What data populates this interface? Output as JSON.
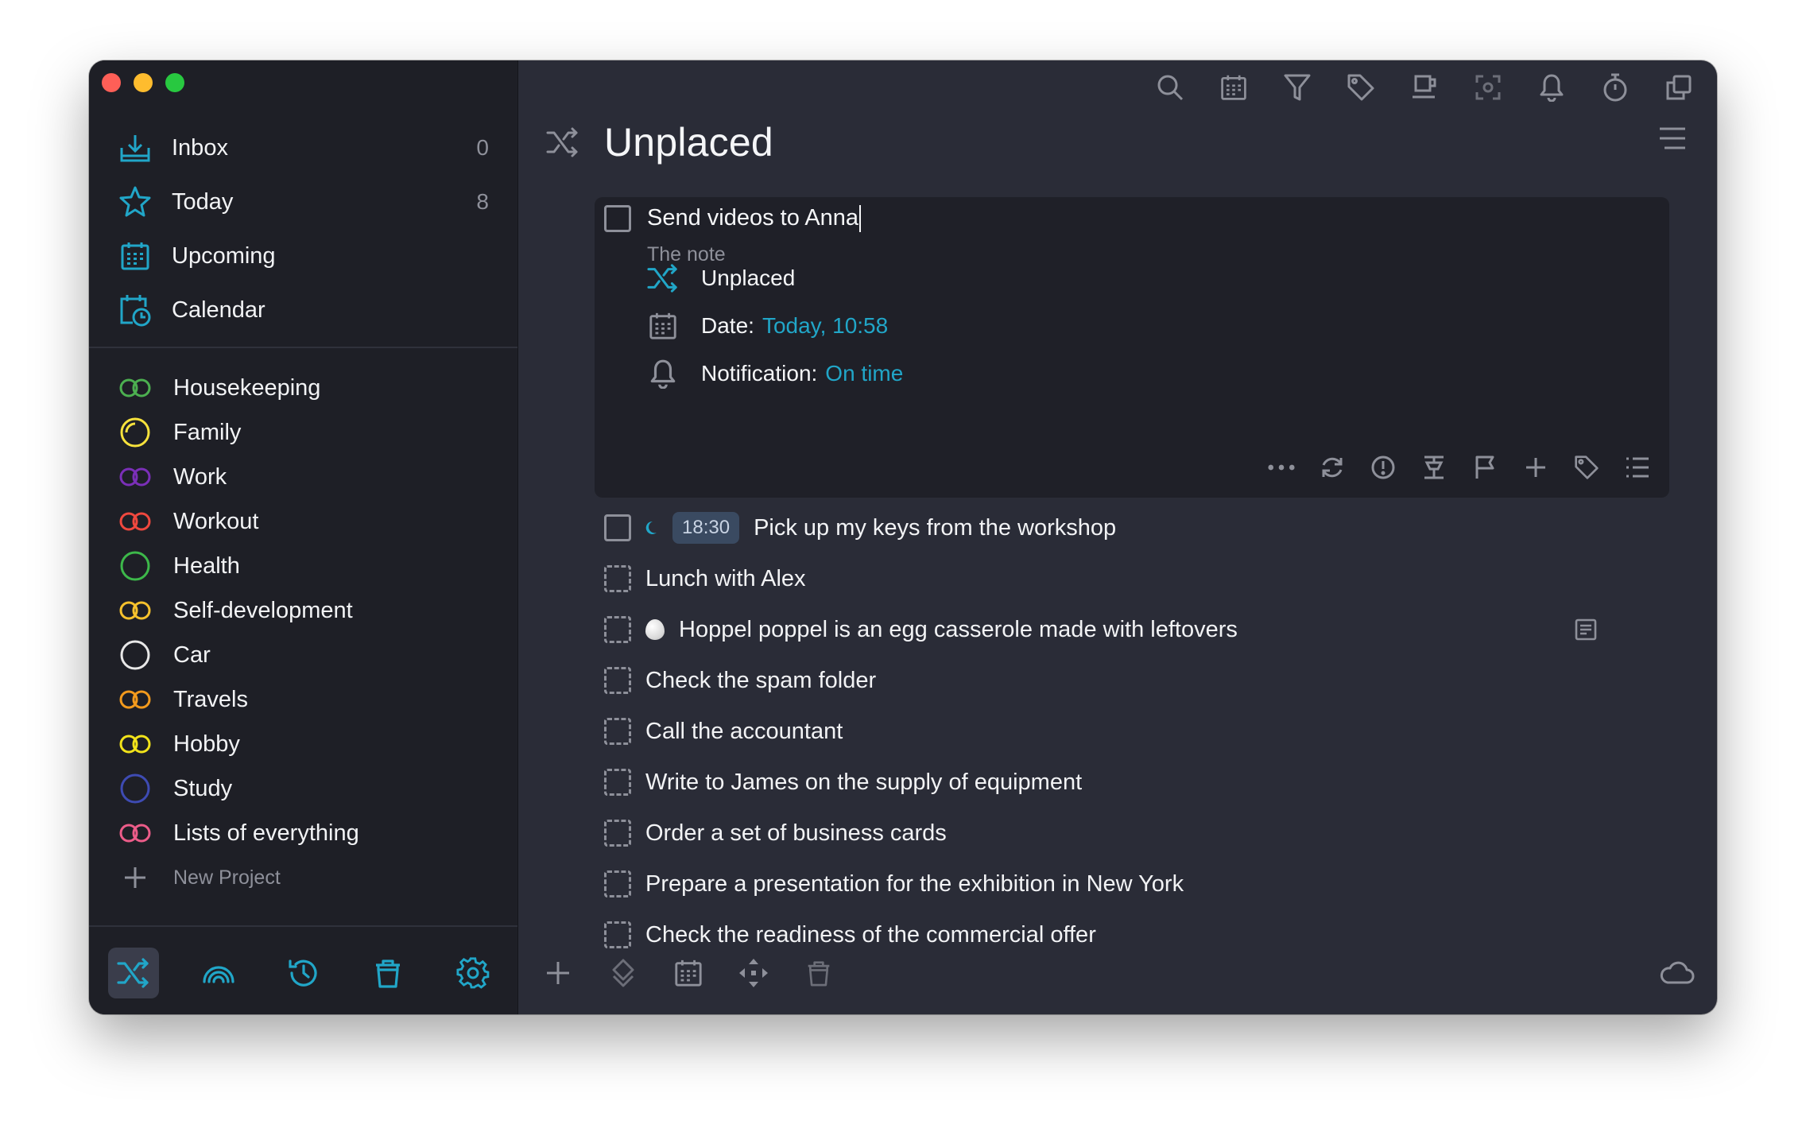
{
  "sidebar": {
    "nav": [
      {
        "label": "Inbox",
        "count": "0",
        "icon": "inbox-icon"
      },
      {
        "label": "Today",
        "count": "8",
        "icon": "star-icon"
      },
      {
        "label": "Upcoming",
        "count": "",
        "icon": "calendar-grid-icon"
      },
      {
        "label": "Calendar",
        "count": "",
        "icon": "calendar-clock-icon"
      }
    ],
    "projects": [
      {
        "label": "Housekeeping",
        "color": "#4caf50"
      },
      {
        "label": "Family",
        "color": "#f7e23c"
      },
      {
        "label": "Work",
        "color": "#7b2fb8"
      },
      {
        "label": "Workout",
        "color": "#f0483e"
      },
      {
        "label": "Health",
        "color": "#3db84a"
      },
      {
        "label": "Self-development",
        "color": "#f6c12d"
      },
      {
        "label": "Car",
        "color": "#e8e8e8"
      },
      {
        "label": "Travels",
        "color": "#f39a1d"
      },
      {
        "label": "Hobby",
        "color": "#f2e31a"
      },
      {
        "label": "Study",
        "color": "#3e4bb3"
      },
      {
        "label": "Lists of everything",
        "color": "#ec5c89"
      }
    ],
    "new_project_label": "New Project"
  },
  "accent": "#21a6c8",
  "header": {
    "title": "Unplaced"
  },
  "editor": {
    "title": "Send videos to Anna",
    "note": "The note",
    "project": "Unplaced",
    "date_label": "Date:",
    "date_value": "Today, 10:58",
    "notification_label": "Notification:",
    "notification_value": "On time"
  },
  "tasks": [
    {
      "text": "Pick up my keys from the workshop",
      "time": "18:30",
      "evening": true,
      "checkbox": "solid"
    },
    {
      "text": "Lunch with Alex",
      "checkbox": "dashed"
    },
    {
      "text": "Hoppel poppel is an egg casserole made with leftovers",
      "checkbox": "dashed",
      "egg": true,
      "has_note": true
    },
    {
      "text": "Check the spam folder",
      "checkbox": "dashed"
    },
    {
      "text": "Call the accountant",
      "checkbox": "dashed"
    },
    {
      "text": "Write to James on the supply of equipment",
      "checkbox": "dashed"
    },
    {
      "text": "Order a set of business cards",
      "checkbox": "dashed"
    },
    {
      "text": "Prepare a presentation for the exhibition in New York",
      "checkbox": "dashed"
    },
    {
      "text": "Check the readiness of the commercial offer",
      "checkbox": "dashed"
    }
  ]
}
